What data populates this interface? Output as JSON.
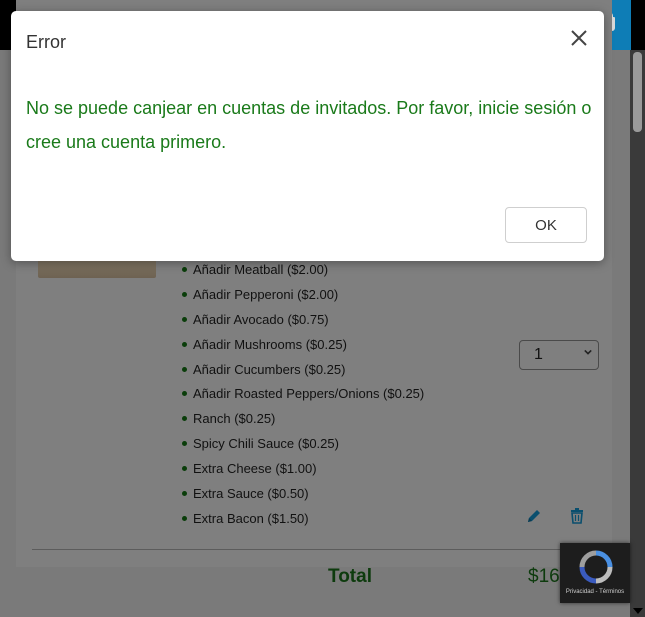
{
  "modal": {
    "title": "Error",
    "message": "No se puede canjear en cuentas de invitados. Por favor, inicie sesión o cree una cuenta primero.",
    "ok_label": "OK",
    "close_icon": "close-icon"
  },
  "cart": {
    "modifiers": [
      "Añadir Meatball ($2.00)",
      "Añadir Pepperoni ($2.00)",
      "Añadir Avocado ($0.75)",
      "Añadir Mushrooms ($0.25)",
      "Añadir Cucumbers ($0.25)",
      "Añadir Roasted Peppers/Onions ($0.25)",
      "Ranch ($0.25)",
      "Spicy Chili Sauce ($0.25)",
      "Extra Cheese ($1.00)",
      "Extra Sauce ($0.50)",
      "Extra Bacon ($1.50)"
    ],
    "quantity": "1",
    "total_label": "Total",
    "total_value": "$16"
  },
  "recaptcha": {
    "terms": "Privacidad - Términos"
  },
  "colors": {
    "accent": "#0e7db6",
    "success_text": "#1a7a1a",
    "total_text": "#0d3b0d"
  }
}
